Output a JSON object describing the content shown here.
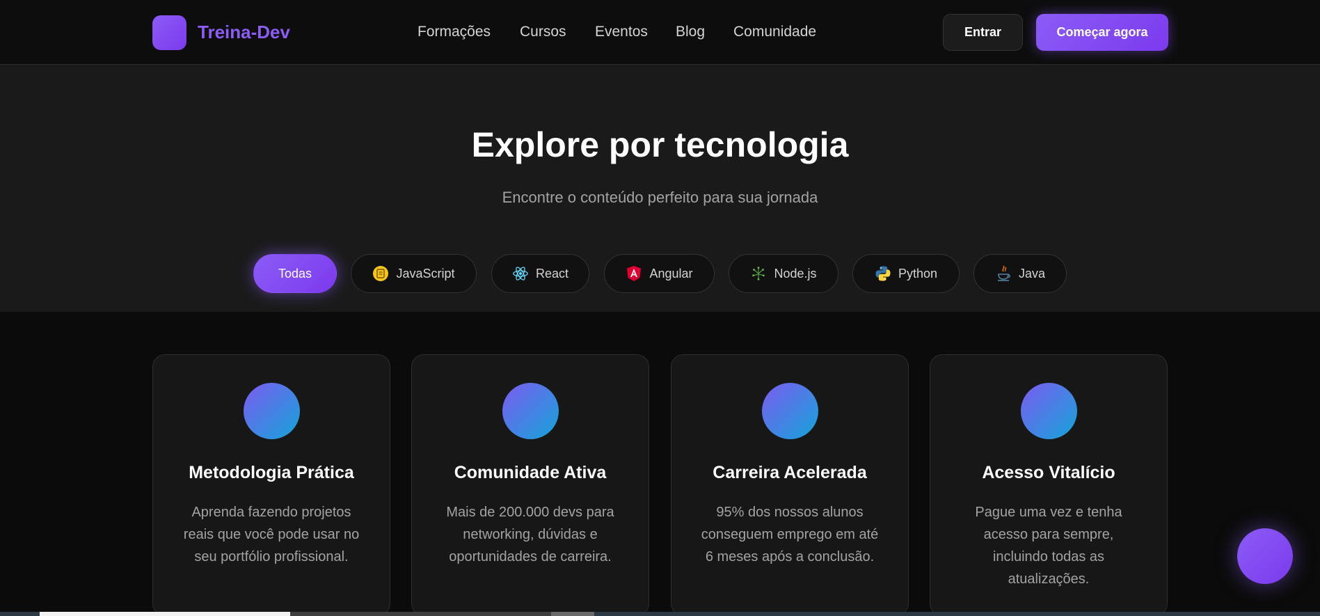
{
  "header": {
    "brand": "Treina-Dev",
    "nav": [
      "Formações",
      "Cursos",
      "Eventos",
      "Blog",
      "Comunidade"
    ],
    "login_label": "Entrar",
    "cta_label": "Começar agora"
  },
  "explore": {
    "title": "Explore por tecnologia",
    "subtitle": "Encontre o conteúdo perfeito para sua jornada",
    "filters": [
      {
        "label": "Todas",
        "icon": "",
        "active": true
      },
      {
        "label": "JavaScript",
        "icon": "javascript-icon",
        "active": false
      },
      {
        "label": "React",
        "icon": "react-icon",
        "active": false
      },
      {
        "label": "Angular",
        "icon": "angular-icon",
        "active": false
      },
      {
        "label": "Node.js",
        "icon": "nodejs-icon",
        "active": false
      },
      {
        "label": "Python",
        "icon": "python-icon",
        "active": false
      },
      {
        "label": "Java",
        "icon": "java-icon",
        "active": false
      }
    ]
  },
  "features": [
    {
      "title": "Metodologia Prática",
      "text": "Aprenda fazendo projetos reais que você pode usar no seu portfólio profissional."
    },
    {
      "title": "Comunidade Ativa",
      "text": "Mais de 200.000 devs para networking, dúvidas e oportunidades de carreira."
    },
    {
      "title": "Carreira Acelerada",
      "text": "95% dos nossos alunos conseguem emprego em até 6 meses após a conclusão."
    },
    {
      "title": "Acesso Vitalício",
      "text": "Pague uma vez e tenha acesso para sempre, incluindo todas as atualizações."
    }
  ],
  "colors": {
    "accent": "#8b5cf6",
    "background": "#0b0b0b",
    "section": "#1a1a1a"
  }
}
